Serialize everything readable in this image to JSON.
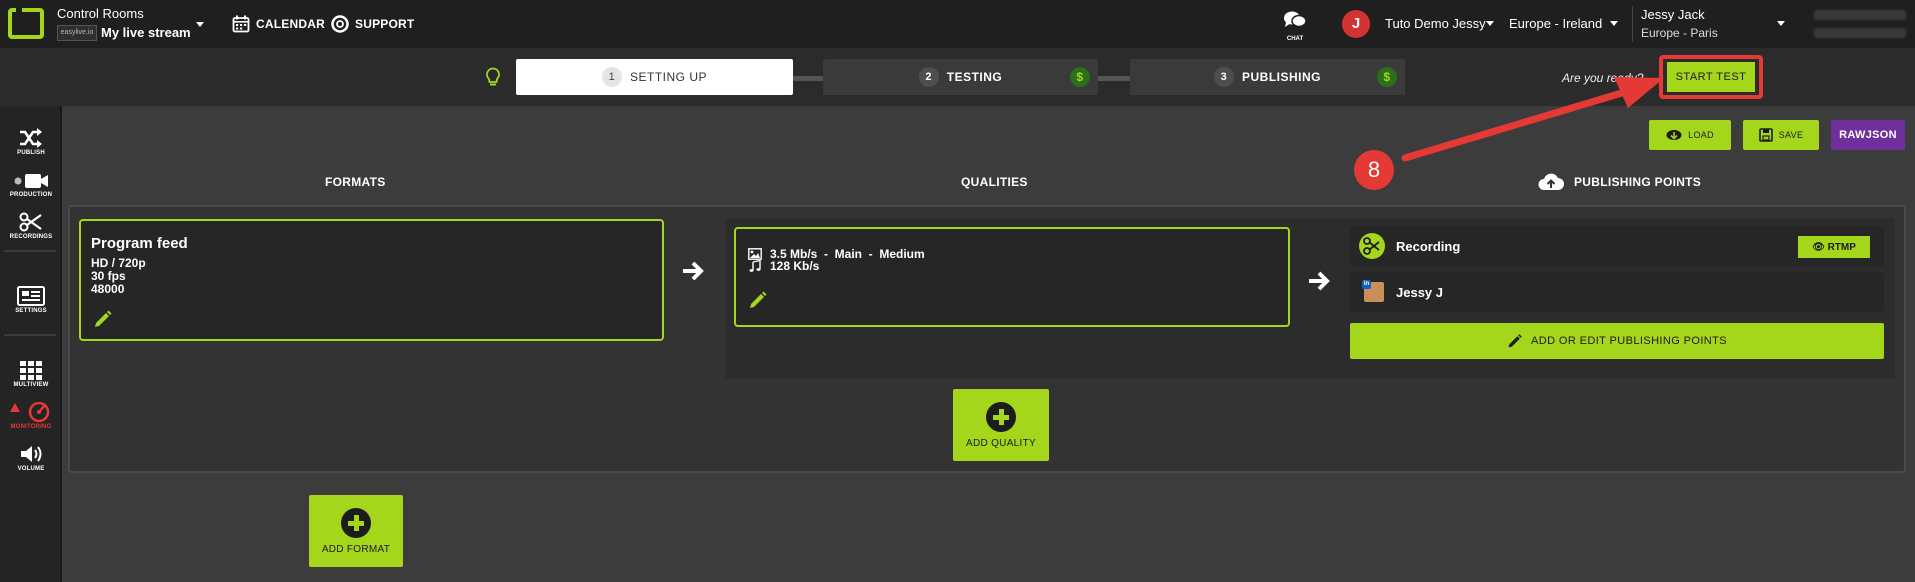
{
  "topbar": {
    "app_title": "Control Rooms",
    "live_badge": "easylive.io",
    "stream_name": "My live stream",
    "calendar_label": "CALENDAR",
    "support_label": "SUPPORT",
    "chat_label": "CHAT",
    "avatar_initial": "J",
    "account_name": "Tuto Demo Jessy",
    "region": "Europe - Ireland",
    "user_name": "Jessy Jack",
    "user_timezone": "Europe - Paris"
  },
  "steps": [
    {
      "number": "1",
      "label": "SETTING UP"
    },
    {
      "number": "2",
      "label": "TESTING",
      "badge": "$"
    },
    {
      "number": "3",
      "label": "PUBLISHING",
      "badge": "$"
    }
  ],
  "ready_text": "Are you ready?",
  "start_test_label": "START TEST",
  "annotation_number": "8",
  "sidebar": [
    {
      "label": "PUBLISH"
    },
    {
      "label": "PRODUCTION"
    },
    {
      "label": "RECORDINGS"
    },
    {
      "label": "SETTINGS"
    },
    {
      "label": "MULTIVIEW"
    },
    {
      "label": "MONITORING"
    },
    {
      "label": "VOLUME"
    }
  ],
  "actions": {
    "load_label": "LOAD",
    "save_label": "SAVE",
    "rawjson_label": "RAWJSON"
  },
  "columns": {
    "formats": "FORMATS",
    "qualities": "QUALITIES",
    "publishing_points": "PUBLISHING POINTS"
  },
  "format": {
    "title": "Program feed",
    "resolution": "HD / 720p",
    "fps": "30 fps",
    "sample_rate": "48000"
  },
  "quality": {
    "video": "3.5 Mb/s  -  Main  -  Medium",
    "audio": "128 Kb/s"
  },
  "publishing_points": [
    {
      "name": "Recording",
      "action": "RTMP"
    },
    {
      "name": "Jessy J"
    }
  ],
  "add_pp_label": "ADD OR EDIT PUBLISHING POINTS",
  "add_quality_label": "ADD QUALITY",
  "add_format_label": "ADD FORMAT",
  "colors": {
    "accent": "#a4d61c",
    "annotation": "#e53935",
    "rawjson": "#6f2f9c"
  }
}
